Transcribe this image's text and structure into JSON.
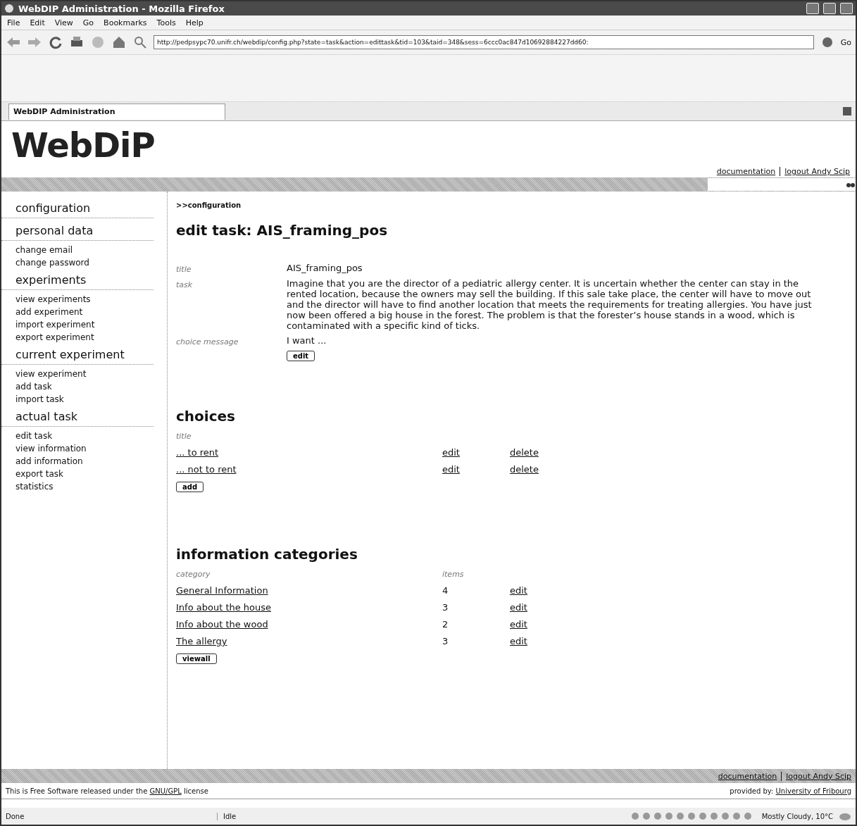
{
  "window": {
    "title": "WebDIP Administration - Mozilla Firefox"
  },
  "menu": [
    "File",
    "Edit",
    "View",
    "Go",
    "Bookmarks",
    "Tools",
    "Help"
  ],
  "address_bar": {
    "url": "http://pedpsypc70.unifr.ch/webdip/config.php?state=task&action=edittask&tid=103&taid=348&sess=6ccc0ac847d10692884227dd60:",
    "go": "Go"
  },
  "browser_tab": {
    "title": "WebDIP Administration"
  },
  "header": {
    "logo": "WebDiP",
    "links": [
      "documentation",
      "logout Andy Scip"
    ]
  },
  "sidebar": [
    {
      "heading": "configuration"
    },
    {
      "heading": "personal data",
      "items": [
        "change email",
        "change password"
      ]
    },
    {
      "heading": "experiments",
      "items": [
        "view experiments",
        "add experiment",
        "import experiment",
        "export experiment"
      ]
    },
    {
      "heading": "current experiment",
      "items": [
        "view experiment",
        "add task",
        "import task"
      ]
    },
    {
      "heading": "actual task",
      "items": [
        "edit task",
        "view information",
        "add information",
        "export task",
        "statistics"
      ]
    }
  ],
  "breadcrumb": ">>configuration",
  "page_title": "edit task: AIS_framing_pos",
  "task_fields": [
    {
      "label": "title",
      "value": "AIS_framing_pos"
    },
    {
      "label": "task",
      "value": "Imagine that you are the director of a pediatric allergy center. It is uncertain whether the center can stay in the rented location, because the owners may sell the building. If this sale take place, the center will have to move out and the director will have to find another location that meets the requirements for treating allergies. You have just now been offered a big house in the forest. The problem is that the forester’s house stands in a wood, which is contaminated with a specific kind of ticks."
    },
    {
      "label": "choice message",
      "value": "I want ..."
    }
  ],
  "edit_button": "edit",
  "choices": {
    "heading": "choices",
    "column_1": "title",
    "rows": [
      {
        "title": "... to rent",
        "edit": "edit",
        "delete": "delete"
      },
      {
        "title": "... not to rent",
        "edit": "edit",
        "delete": "delete"
      }
    ],
    "add_button": "add"
  },
  "categories": {
    "heading": "information categories",
    "columns": [
      "category",
      "items"
    ],
    "rows": [
      {
        "category": "General Information",
        "items": "4",
        "edit": "edit"
      },
      {
        "category": "Info about the house",
        "items": "3",
        "edit": "edit"
      },
      {
        "category": "Info about the wood",
        "items": "2",
        "edit": "edit"
      },
      {
        "category": "The allergy",
        "items": "3",
        "edit": "edit"
      }
    ],
    "view_all_button": "viewall"
  },
  "footer": {
    "links": [
      "documentation",
      "logout Andy Scip"
    ],
    "license_before": "This is Free Software released under the ",
    "license_link": "GNU/GPL",
    "license_after": " license",
    "provided_label": "provided by:",
    "provided_link": "University of Fribourg"
  },
  "status_bar": {
    "state": "Done",
    "activity": "Idle",
    "weather": "Mostly Cloudy, 10°C"
  }
}
